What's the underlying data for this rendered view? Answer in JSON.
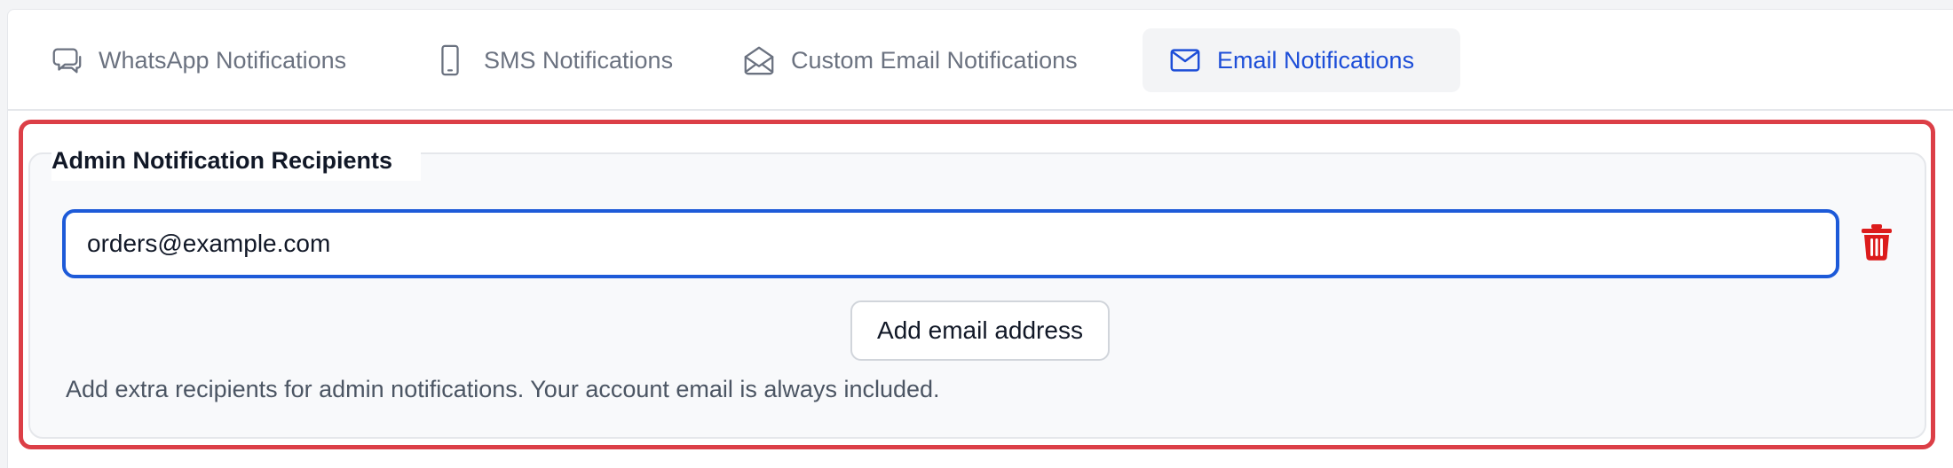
{
  "tabs": [
    {
      "label": "WhatsApp Notifications",
      "icon": "chat-bubble-icon",
      "active": false
    },
    {
      "label": "SMS Notifications",
      "icon": "phone-icon",
      "active": false
    },
    {
      "label": "Custom Email Notifications",
      "icon": "envelope-open-icon",
      "active": false
    },
    {
      "label": "Email Notifications",
      "icon": "envelope-icon",
      "active": true
    }
  ],
  "section": {
    "legend": "Admin Notification Recipients",
    "email_value": "orders@example.com",
    "add_button_label": "Add email address",
    "help_text": "Add extra recipients for admin notifications. Your account email is always included."
  },
  "colors": {
    "active_tab": "#1d4ed8",
    "highlight_border": "#dc3f47",
    "input_focus_border": "#1d5ad8",
    "delete_icon": "#dc1c1c"
  }
}
